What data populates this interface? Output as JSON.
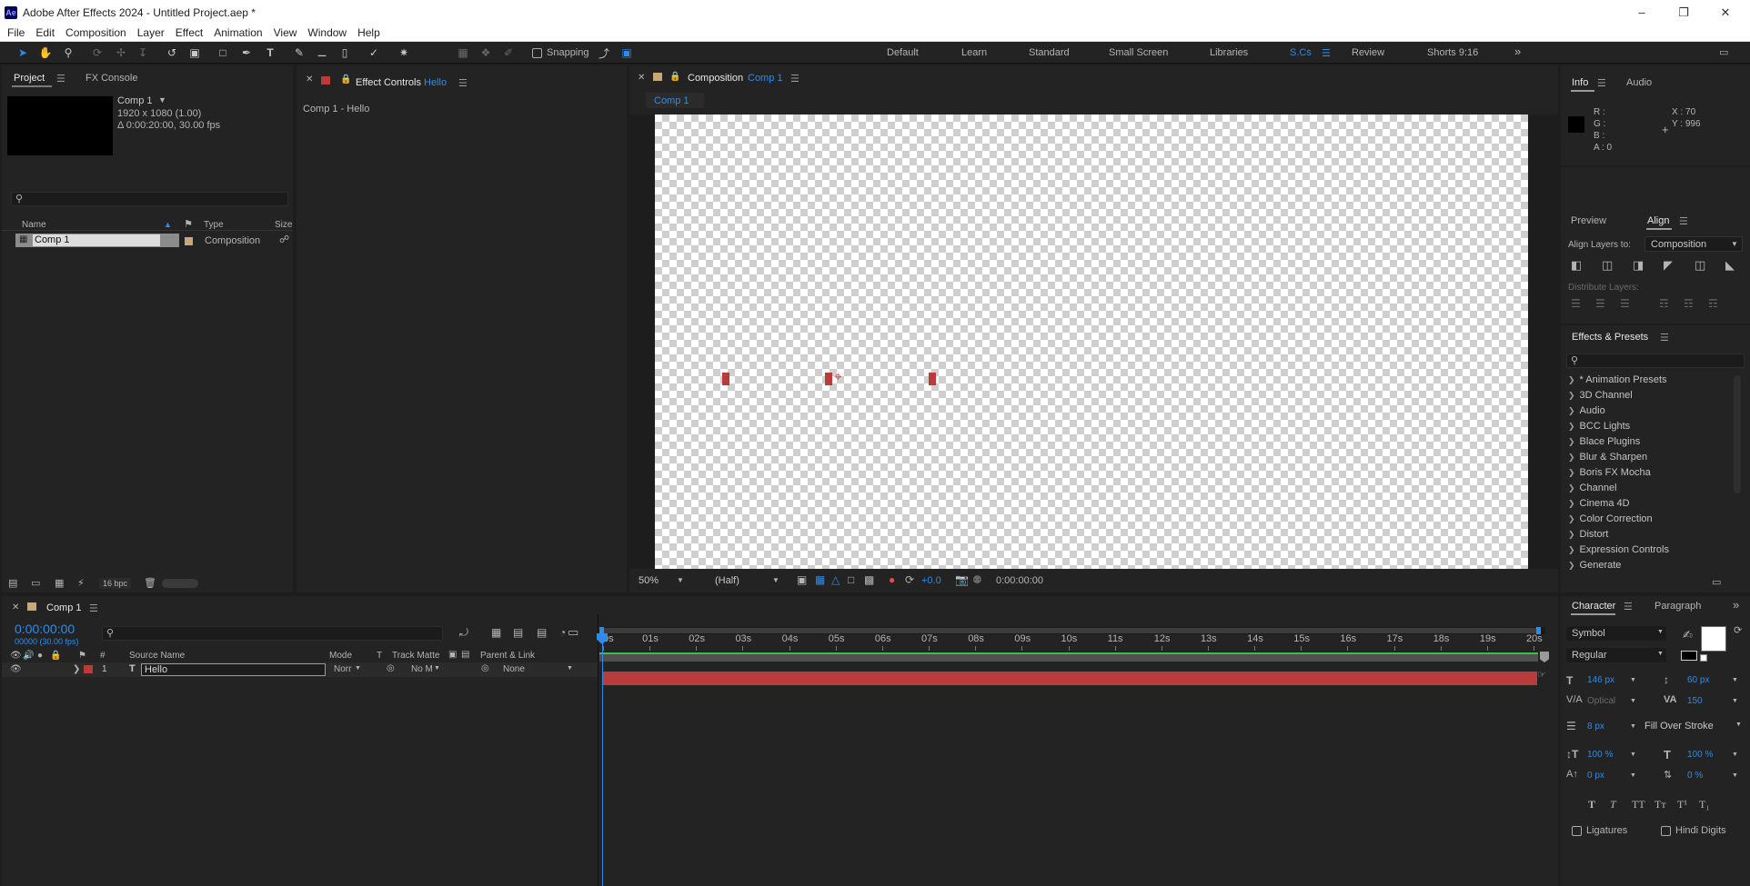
{
  "window": {
    "title": "Adobe After Effects 2024 - Untitled Project.aep *",
    "app_icon": "Ae"
  },
  "menu": [
    "File",
    "Edit",
    "Composition",
    "Layer",
    "Effect",
    "Animation",
    "View",
    "Window",
    "Help"
  ],
  "toolbar": {
    "snapping_label": "Snapping"
  },
  "workspaces": [
    "Default",
    "Learn",
    "Standard",
    "Small Screen",
    "Libraries",
    "S.Cs",
    "Review",
    "Shorts 9:16"
  ],
  "active_workspace": "S.Cs",
  "project_panel": {
    "tabs": [
      "Project",
      "FX Console"
    ],
    "comp_name": "Comp 1",
    "comp_res": "1920 x 1080 (1.00)",
    "comp_duration": "Δ 0:00:20:00, 30.00 fps",
    "search_placeholder": "",
    "columns": {
      "name": "Name",
      "type": "Type",
      "size": "Size"
    },
    "items": [
      {
        "name": "Comp 1",
        "type": "Composition"
      }
    ],
    "bpc": "16 bpc"
  },
  "effect_controls": {
    "title": "Effect Controls",
    "layer": "Hello",
    "breadcrumb": "Comp 1 - Hello"
  },
  "composition_panel": {
    "title": "Composition",
    "comp": "Comp 1",
    "subtab": "Comp 1",
    "zoom": "50%",
    "resolution": "(Half)",
    "exposure": "+0.0",
    "timecode": "0:00:00:00"
  },
  "info_panel": {
    "tabs": [
      "Info",
      "Audio"
    ],
    "r": "R :",
    "g": "G :",
    "b": "B :",
    "a": "A : 0",
    "x": "X : 70",
    "y": "Y : 996"
  },
  "align_panel": {
    "tabs": [
      "Preview",
      "Align"
    ],
    "align_to_label": "Align Layers to:",
    "align_to_value": "Composition",
    "distribute_label": "Distribute Layers:"
  },
  "effects_presets": {
    "title": "Effects & Presets",
    "items": [
      "* Animation Presets",
      "3D Channel",
      "Audio",
      "BCC Lights",
      "Blace Plugins",
      "Blur & Sharpen",
      "Boris FX Mocha",
      "Channel",
      "Cinema 4D",
      "Color Correction",
      "Distort",
      "Expression Controls",
      "Generate"
    ]
  },
  "timeline": {
    "comp_tab": "Comp 1",
    "timecode": "0:00:00:00",
    "frames": "00000 (30.00 fps)",
    "columns": {
      "hash": "#",
      "source": "Source Name",
      "mode": "Mode",
      "t": "T",
      "matte": "Track Matte",
      "parent": "Parent & Link"
    },
    "layers": [
      {
        "num": "1",
        "name": "Hello",
        "mode": "Norr",
        "matte": "No M",
        "parent": "None"
      }
    ],
    "ruler": [
      "0s",
      "01s",
      "02s",
      "03s",
      "04s",
      "05s",
      "06s",
      "07s",
      "08s",
      "09s",
      "10s",
      "11s",
      "12s",
      "13s",
      "14s",
      "15s",
      "16s",
      "17s",
      "18s",
      "19s",
      "20s"
    ]
  },
  "character_panel": {
    "tabs": [
      "Character",
      "Paragraph"
    ],
    "font": "Symbol",
    "style": "Regular",
    "font_size": "146 px",
    "leading": "60 px",
    "kerning": "Optical",
    "tracking": "150",
    "stroke_width": "8 px",
    "stroke_type": "Fill Over Stroke",
    "vscale": "100 %",
    "hscale": "100 %",
    "baseline": "0 px",
    "tsume": "0 %",
    "ligatures": "Ligatures",
    "hindi_digits": "Hindi Digits"
  },
  "colors": {
    "accent_blue": "#2d8ceb",
    "layer_red": "#b83c3c",
    "label_tan": "#c8a878"
  }
}
